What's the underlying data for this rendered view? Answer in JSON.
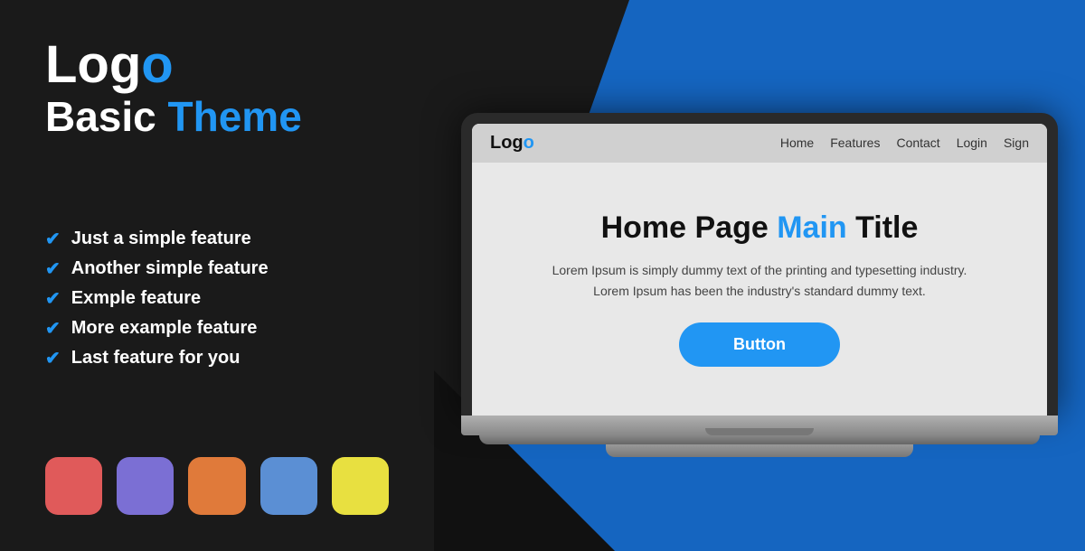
{
  "left": {
    "logo": {
      "prefix": "Log",
      "o": "o",
      "subtitle_bold": "Basic ",
      "subtitle_blue": "Theme"
    },
    "features": [
      "Just a simple feature",
      "Another simple feature",
      "Exmple feature",
      "More example feature",
      "Last feature for you"
    ],
    "swatches": [
      {
        "color": "#e05a5a",
        "label": "red-swatch"
      },
      {
        "color": "#7b6fd4",
        "label": "purple-swatch"
      },
      {
        "color": "#e07a3a",
        "label": "orange-swatch"
      },
      {
        "color": "#5b8fd4",
        "label": "blue-swatch"
      },
      {
        "color": "#e8e040",
        "label": "yellow-swatch"
      }
    ]
  },
  "browser": {
    "logo_prefix": "Log",
    "logo_o": "o",
    "nav_items": [
      "Home",
      "Features",
      "Contact",
      "Login",
      "Sign"
    ],
    "page_title_part1": "Home Page ",
    "page_title_main": "Main",
    "page_title_part2": " Title",
    "description_line1": "Lorem Ipsum is simply dummy text of the printing and typesetting industry.",
    "description_line2": "Lorem Ipsum has been the industry's standard dummy text.",
    "button_label": "Button"
  }
}
